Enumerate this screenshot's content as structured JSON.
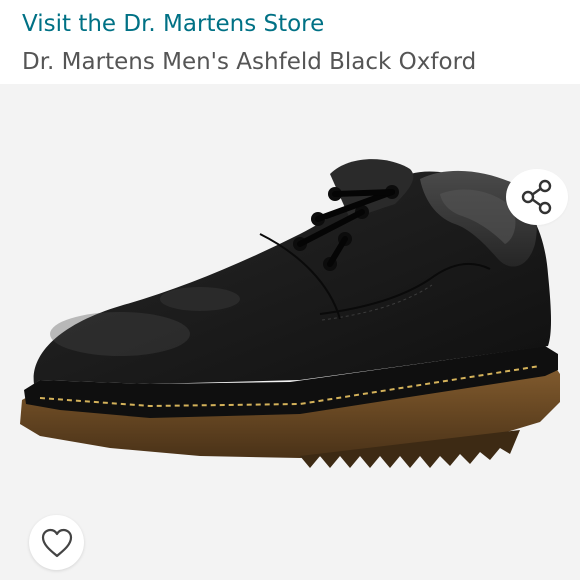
{
  "header": {
    "store_link": "Visit the Dr. Martens Store",
    "product_title": "Dr. Martens Men's Ashfeld Black Oxford"
  },
  "image": {
    "alt": "Black leather oxford shoe with gum sole and yellow welt stitching"
  },
  "actions": {
    "share_icon": "share-icon",
    "favorite_icon": "heart-icon"
  },
  "colors": {
    "link": "#007185",
    "title": "#555555",
    "image_bg": "#f3f3f3"
  }
}
